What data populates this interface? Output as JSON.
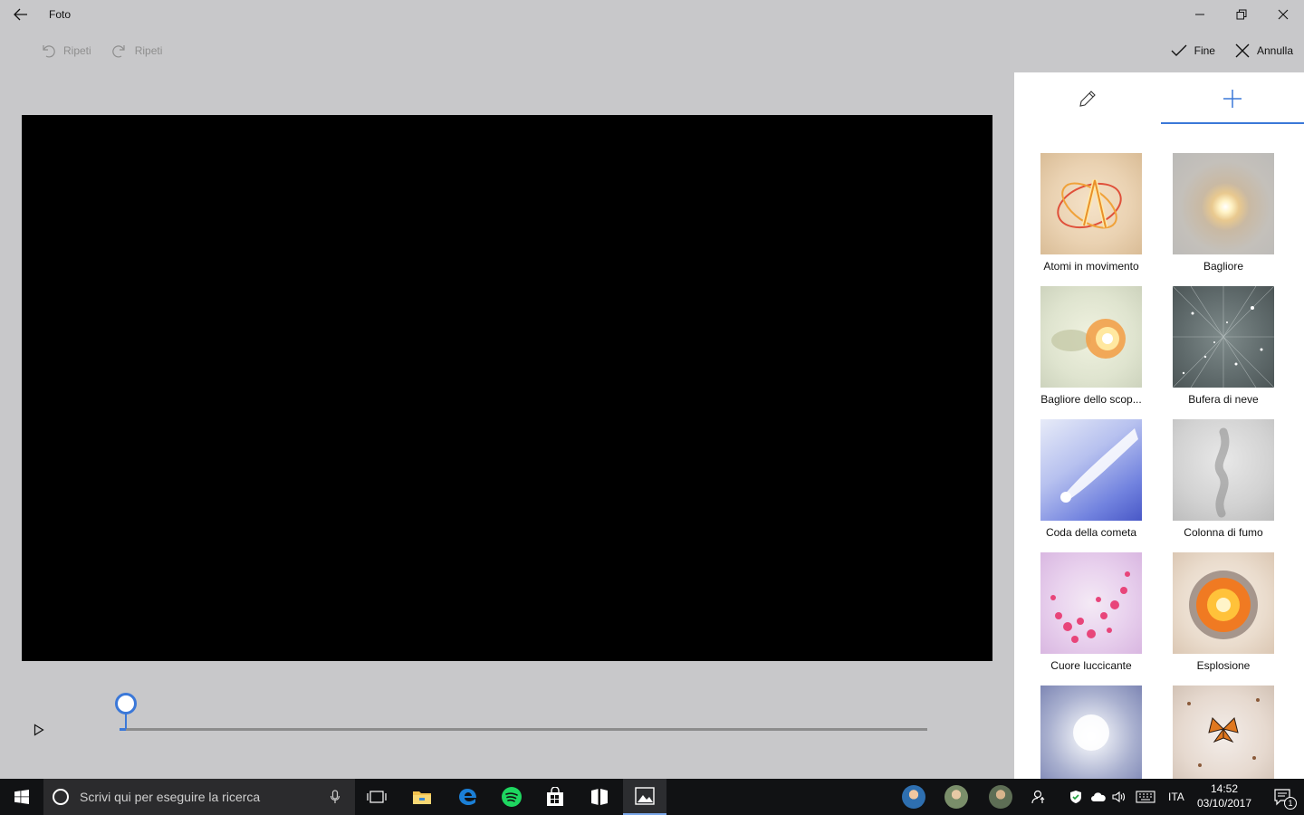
{
  "window": {
    "title": "Foto"
  },
  "toolbar": {
    "undo_label": "Ripeti",
    "redo_label": "Ripeti",
    "done_label": "Fine",
    "cancel_label": "Annulla"
  },
  "timeline": {
    "progress": 0.008
  },
  "panel": {
    "tabs": [
      {
        "icon": "pencil-icon",
        "selected": false
      },
      {
        "icon": "plus-icon",
        "selected": true
      }
    ],
    "effects": [
      {
        "label": "Atomi in movimento"
      },
      {
        "label": "Bagliore"
      },
      {
        "label": "Bagliore dello scop..."
      },
      {
        "label": "Bufera di neve"
      },
      {
        "label": "Coda della cometa"
      },
      {
        "label": "Colonna di fumo"
      },
      {
        "label": "Cuore luccicante"
      },
      {
        "label": "Esplosione"
      },
      {
        "label": ""
      },
      {
        "label": ""
      }
    ]
  },
  "taskbar": {
    "search_placeholder": "Scrivi qui per eseguire la ricerca",
    "language": "ITA",
    "time": "14:52",
    "date": "03/10/2017",
    "notifications_count": "1"
  },
  "colors": {
    "accent": "#3b78d8",
    "background": "#c8c8ca",
    "panel": "#ffffff",
    "taskbar": "#111214"
  }
}
